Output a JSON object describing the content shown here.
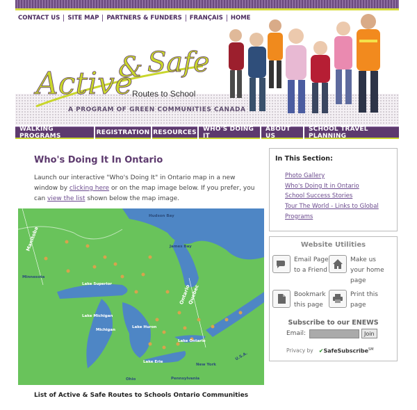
{
  "top_nav": [
    "CONTACT US",
    "SITE MAP",
    "PARTNERS & FUNDERS",
    "FRANÇAIS",
    "HOME"
  ],
  "logo": {
    "word1": "Active",
    "amp": "&",
    "word2": "Safe",
    "sub": "Routes to School"
  },
  "tagline": "A PROGRAM OF GREEN COMMUNITIES CANADA",
  "main_nav": [
    "WALKING PROGRAMS",
    "REGISTRATION",
    "RESOURCES",
    "WHO'S DOING IT",
    "ABOUT US",
    "SCHOOL TRAVEL PLANNING"
  ],
  "content": {
    "title": "Who's Doing It In Ontario",
    "intro_1": "Launch our interactive \"Who's Doing It\" in Ontario map in a new window by ",
    "intro_link1": "clicking here",
    "intro_2": " or on the map image below. If you prefer, you can ",
    "intro_link2": "view the list",
    "intro_3": " shown below the map image.",
    "list_title": "List of Active & Safe Routes to Schools Ontario Communities"
  },
  "map_labels": {
    "manitoba": "Manitoba",
    "ontario": "Ontario",
    "quebec": "Quebec",
    "hudson_bay": "Hudson Bay",
    "james_bay": "James Bay",
    "minnesota": "Minnesota",
    "lake_superior": "Lake Superior",
    "lake_michigan": "Lake Michigan",
    "michigan": "Michigan",
    "lake_huron": "Lake Huron",
    "lake_ontario": "Lake Ontario",
    "lake_erie": "Lake Erie",
    "new_york": "New York",
    "pennsylvania": "Pennsylvania",
    "ohio": "Ohio",
    "usa": "U.S.A."
  },
  "sidebar": {
    "section_title": "In This Section:",
    "links": [
      "Photo Gallery",
      "Who's Doing It in Ontario",
      "School Success Stories",
      "Tour The World - Links to Global Programs"
    ],
    "utilities_title": "Website Utilities",
    "email_friend": "Email Page to a Friend",
    "make_home": "Make us your home page",
    "bookmark": "Bookmark this page",
    "print": "Print this page",
    "enews_title": "Subscribe to our ENEWS",
    "email_label": "Email:",
    "join_label": "Join",
    "privacy_label": "Privacy by",
    "safesubscribe": "SafeSubscribe",
    "sm": "SM"
  },
  "colors": {
    "purple": "#5d3a6e",
    "lime": "#c9d62c",
    "map_green": "#69c35b",
    "water": "#4e86c5"
  },
  "icons": [
    "email-page-icon",
    "home-page-icon",
    "bookmark-icon",
    "print-icon",
    "safesubscribe-check-icon"
  ]
}
